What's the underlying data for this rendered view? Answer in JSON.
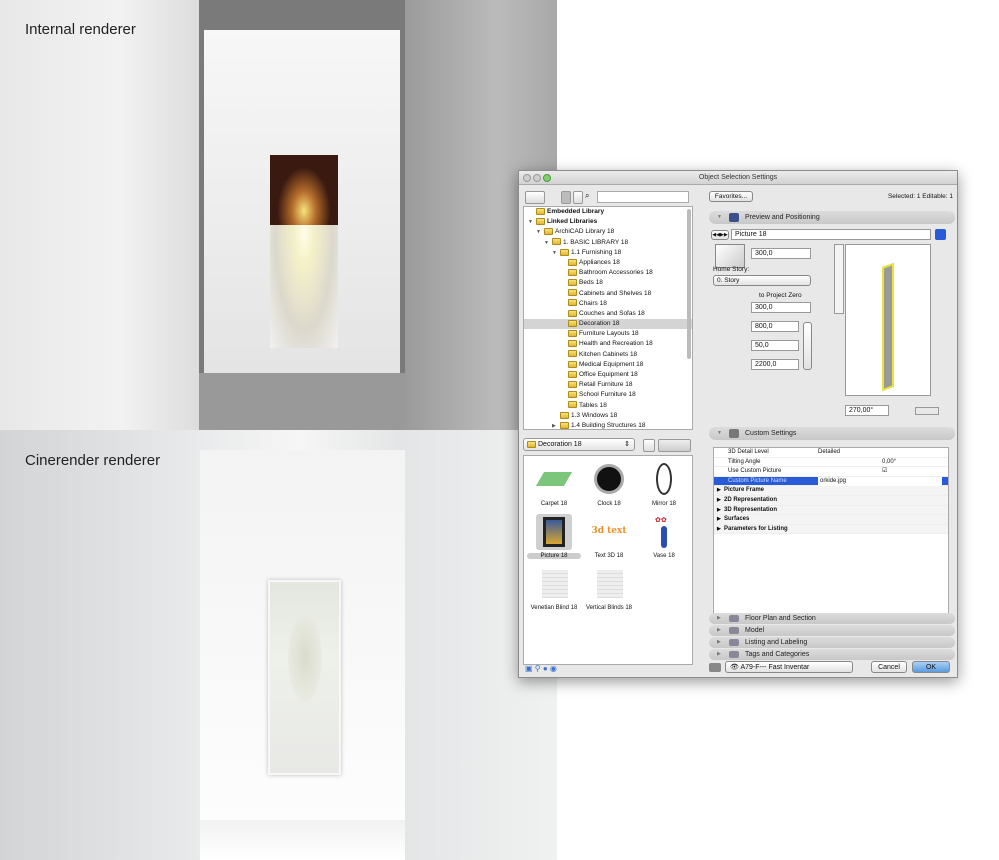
{
  "captions": {
    "top": "Internal renderer",
    "bottom": "Cinerender renderer"
  },
  "dialog": {
    "title": "Object Selection Settings",
    "favorites_label": "Favorites...",
    "selected_text": "Selected: 1 Editable: 1",
    "tree": [
      {
        "label": "Embedded Library",
        "level": 0,
        "bold": true,
        "arrow": ""
      },
      {
        "label": "Linked Libraries",
        "level": 0,
        "bold": true,
        "arrow": "▼"
      },
      {
        "label": "ArchiCAD Library 18",
        "level": 1,
        "arrow": "▼"
      },
      {
        "label": "1. BASIC LIBRARY 18",
        "level": 2,
        "arrow": "▼"
      },
      {
        "label": "1.1 Furnishing 18",
        "level": 3,
        "arrow": "▼"
      },
      {
        "label": "Appliances 18",
        "level": 4
      },
      {
        "label": "Bathroom Accessories 18",
        "level": 4
      },
      {
        "label": "Beds 18",
        "level": 4
      },
      {
        "label": "Cabinets and Shelves 18",
        "level": 4
      },
      {
        "label": "Chairs 18",
        "level": 4
      },
      {
        "label": "Couches and Sofas 18",
        "level": 4
      },
      {
        "label": "Decoration 18",
        "level": 4,
        "selected": true
      },
      {
        "label": "Furniture Layouts 18",
        "level": 4
      },
      {
        "label": "Health and Recreation 18",
        "level": 4
      },
      {
        "label": "Kitchen Cabinets 18",
        "level": 4
      },
      {
        "label": "Medical Equipment 18",
        "level": 4
      },
      {
        "label": "Office Equipment 18",
        "level": 4
      },
      {
        "label": "Retail Furniture 18",
        "level": 4
      },
      {
        "label": "School Furniture 18",
        "level": 4
      },
      {
        "label": "Tables 18",
        "level": 4
      },
      {
        "label": "1.3 Windows 18",
        "level": 3,
        "arrow": ""
      },
      {
        "label": "1.4 Building Structures 18",
        "level": 3,
        "arrow": "▶"
      }
    ],
    "folder_select": "Decoration 18",
    "objects": [
      {
        "label": "Carpet 18",
        "icon": "carpet"
      },
      {
        "label": "Clock 18",
        "icon": "clock"
      },
      {
        "label": "Mirror 18",
        "icon": "mirror"
      },
      {
        "label": "Picture 18",
        "icon": "picture",
        "selected": true
      },
      {
        "label": "Text 3D 18",
        "icon": "text3d",
        "text": "3d text"
      },
      {
        "label": "Vase 18",
        "icon": "vase"
      },
      {
        "label": "Venetian Blind 18",
        "icon": "blind"
      },
      {
        "label": "Vertical Blinds 18",
        "icon": "blind"
      }
    ],
    "preview": {
      "section": "Preview and Positioning",
      "object_name": "Picture 18",
      "elevation": "300,0",
      "home_story_label": "Home Story:",
      "home_story": "0. Story",
      "to_project_zero": "to Project Zero",
      "elevation_zero": "300,0",
      "width": "800,0",
      "depth": "50,0",
      "height": "2200,0",
      "angle": "270,00°"
    },
    "custom": {
      "section": "Custom Settings",
      "rows": [
        {
          "name": "3D Detail Level",
          "value": "Detailed"
        },
        {
          "name": "Tilting Angle",
          "value": "0,00°"
        },
        {
          "name": "Use Custom Picture",
          "value": "☑"
        },
        {
          "name": "Custom Picture Name",
          "value": "orkide.jpg"
        }
      ],
      "groups": [
        "Picture Frame",
        "2D Representation",
        "3D Representation",
        "Surfaces",
        "Parameters for Listing"
      ]
    },
    "sections": [
      "Floor Plan and Section",
      "Model",
      "Listing and Labeling",
      "Tags and Categories"
    ],
    "layer": "A79-F--- Fast Inventar",
    "cancel": "Cancel",
    "ok": "OK",
    "accent": "#2a5bd7"
  }
}
